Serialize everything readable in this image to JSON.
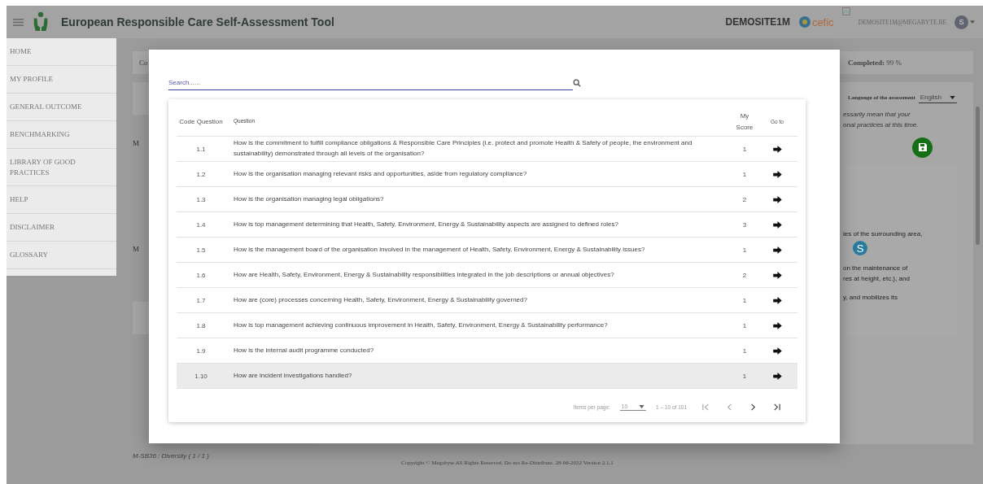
{
  "header": {
    "title": "European Responsible Care Self-Assessment Tool",
    "site": "DEMOSITE1M",
    "partner": "cefic",
    "user_email": "DEMOSITE1M@MEGABYTE.BE",
    "avatar": "S"
  },
  "sidebar": {
    "items": [
      {
        "label": "HOME"
      },
      {
        "label": "MY PROFILE"
      },
      {
        "label": "GENERAL OUTCOME"
      },
      {
        "label": "BENCHMARKING"
      },
      {
        "label": "LIBRARY OF GOOD PRACTICES"
      },
      {
        "label": "HELP"
      },
      {
        "label": "DISCLAIMER"
      },
      {
        "label": "GLOSSARY"
      }
    ]
  },
  "background": {
    "top_bar_text": "Co",
    "completed_label": "Completed:",
    "completed_value": "99 %",
    "language_label": "Language of the assessment",
    "language_value": "English",
    "left_marks": [
      "M",
      "M"
    ],
    "note_lines": [
      "essarily mean that your",
      "onal practices at this time."
    ],
    "panel_lines": [
      "ies of the surrounding area,",
      "on the maintenance of",
      "res at height, etc.), and",
      "y, and mobilizes its"
    ],
    "badge": "S",
    "module_item": "M-SB36 : Diversity ( 1 / 1 )",
    "footer": "Copyright © Megabyte All Rights Reserved. Do not Re-Distribute. 28-06-2022 Version 2.1.1"
  },
  "dialog": {
    "search": {
      "placeholder": "Search......"
    },
    "table": {
      "columns": [
        "Code Question",
        "Question",
        "My Score",
        "Go to"
      ],
      "rows": [
        {
          "code": "1.1",
          "question": "How is the commitment to fulfill compliance obligations & Responsible Care Principles (i.e. protect and promote Health & Safety of people, the environment and sustainability) demonstrated through all levels of the organisation?",
          "score": "1",
          "selected": false
        },
        {
          "code": "1.2",
          "question": "How is the organisation managing relevant risks and opportunities, aside from regulatory compliance?",
          "score": "1",
          "selected": false
        },
        {
          "code": "1.3",
          "question": "How is the organisation managing legal obligations?",
          "score": "2",
          "selected": false
        },
        {
          "code": "1.4",
          "question": "How is top management determining that Health, Safety, Environment, Energy & Sustainability aspects are assigned to defined roles?",
          "score": "3",
          "selected": false
        },
        {
          "code": "1.5",
          "question": "How is the management board of the organisation involved in the management of Health, Safety, Environment, Energy & Sustainability issues?",
          "score": "1",
          "selected": false
        },
        {
          "code": "1.6",
          "question": "How are Health, Safety, Environment, Energy & Sustainability responsibilities integrated in the job descriptions or annual objectives?",
          "score": "2",
          "selected": false
        },
        {
          "code": "1.7",
          "question": "How are (core) processes concerning Health, Safety, Environment, Energy & Sustainability governed?",
          "score": "1",
          "selected": false
        },
        {
          "code": "1.8",
          "question": "How is top management achieving continuous improvement in Health, Safety, Environment, Energy & Sustainability performance?",
          "score": "1",
          "selected": false
        },
        {
          "code": "1.9",
          "question": "How is the internal audit programme conducted?",
          "score": "1",
          "selected": false
        },
        {
          "code": "1.10",
          "question": "How are incident investigations handled?",
          "score": "1",
          "selected": true
        }
      ]
    },
    "paginator": {
      "items_label": "Items per page:",
      "page_size": "10",
      "range": "1 – 10 of 101"
    }
  }
}
